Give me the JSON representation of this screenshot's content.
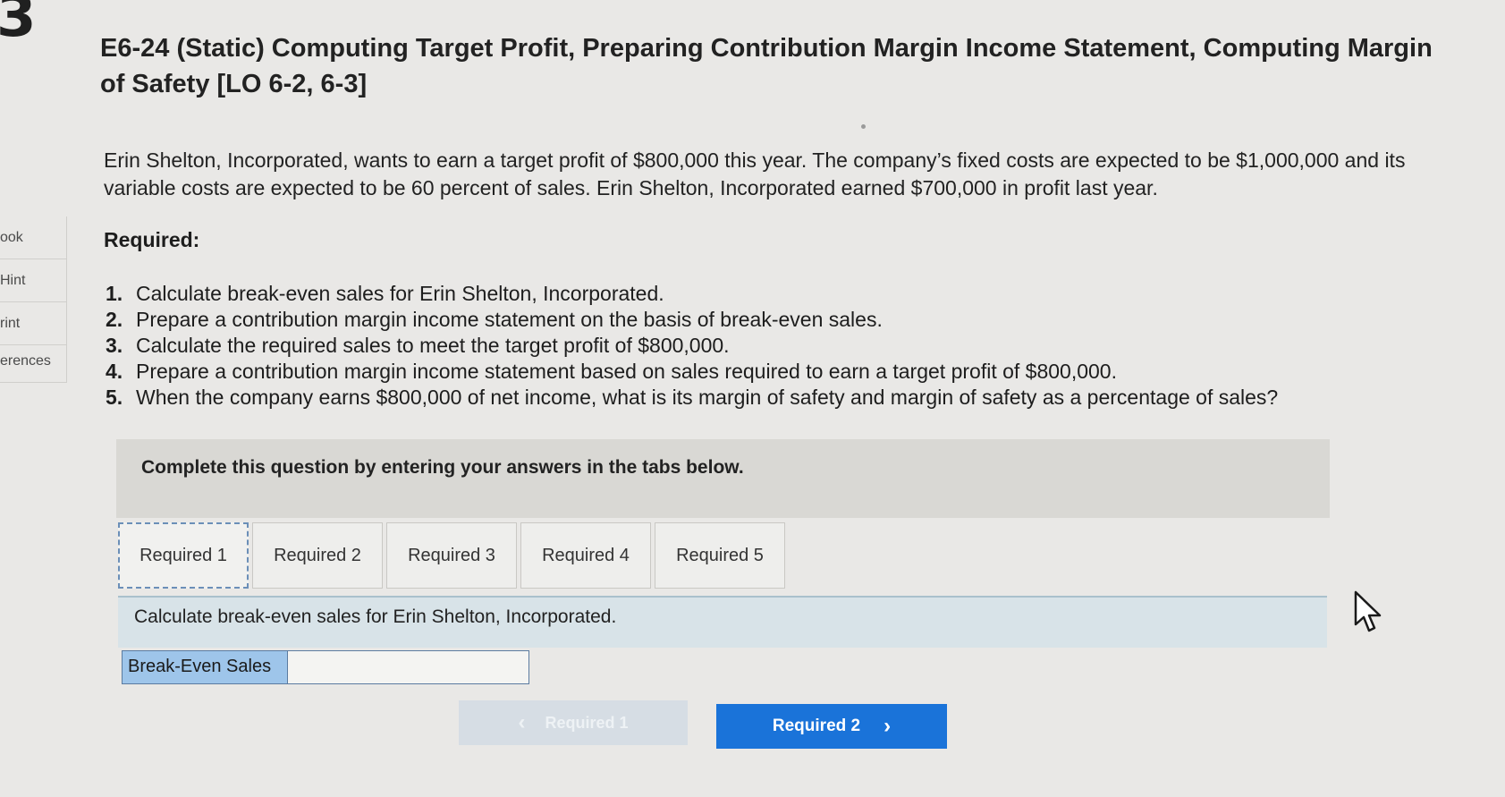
{
  "sidebar": {
    "number": "3",
    "items": [
      {
        "label": "ook"
      },
      {
        "label": "Hint"
      },
      {
        "label": "rint"
      },
      {
        "label": "erences"
      }
    ]
  },
  "title": "E6-24 (Static) Computing Target Profit, Preparing Contribution Margin Income Statement, Computing Margin of Safety [LO 6-2, 6-3]",
  "intro": "Erin Shelton, Incorporated, wants to earn a target profit of $800,000 this year. The company’s fixed costs are expected to be $1,000,000 and its variable costs are expected to be 60 percent of sales. Erin Shelton, Incorporated earned $700,000 in profit last year.",
  "required_label": "Required:",
  "requirements": [
    {
      "num": "1.",
      "text": "Calculate break-even sales for Erin Shelton, Incorporated."
    },
    {
      "num": "2.",
      "text": "Prepare a contribution margin income statement on the basis of break-even sales."
    },
    {
      "num": "3.",
      "text": "Calculate the required sales to meet the target profit of $800,000."
    },
    {
      "num": "4.",
      "text": "Prepare a contribution margin income statement based on sales required to earn a target profit of $800,000."
    },
    {
      "num": "5.",
      "text": "When the company earns $800,000 of net income, what is its margin of safety and margin of safety as a percentage of sales?"
    }
  ],
  "instruction": "Complete this question by entering your answers in the tabs below.",
  "tabs": [
    {
      "label": "Required 1"
    },
    {
      "label": "Required 2"
    },
    {
      "label": "Required 3"
    },
    {
      "label": "Required 4"
    },
    {
      "label": "Required 5"
    }
  ],
  "content_prompt": "Calculate break-even sales for Erin Shelton, Incorporated.",
  "answer": {
    "label": "Break-Even Sales",
    "value": ""
  },
  "nav": {
    "prev_label": "Required 1",
    "next_label": "Required 2"
  },
  "colors": {
    "next_button": "#1a73d9",
    "answer_label_bg": "#9ec5ea",
    "content_bar_bg": "#d8e3e8"
  }
}
